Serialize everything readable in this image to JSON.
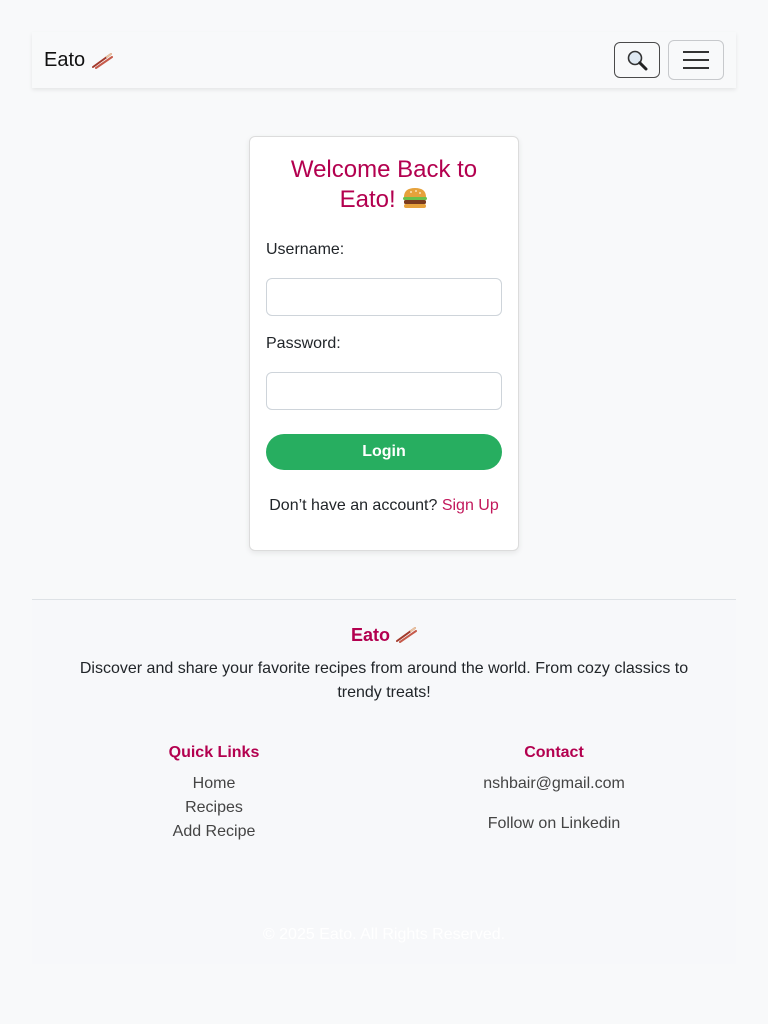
{
  "navbar": {
    "brand": "Eato",
    "brand_icon": "chopsticks-icon",
    "search_icon": "magnifier-icon",
    "menu_icon": "hamburger-menu-icon"
  },
  "login": {
    "title": "Welcome Back to Eato!",
    "title_icon": "burger-icon",
    "username_label": "Username:",
    "username_value": "",
    "password_label": "Password:",
    "password_value": "",
    "button_label": "Login",
    "signup_prompt": "Don’t have an account?",
    "signup_link": "Sign Up"
  },
  "footer": {
    "brand": "Eato",
    "description": "Discover and share your favorite recipes from around the world. From cozy classics to trendy treats!",
    "quick_links": {
      "title": "Quick Links",
      "items": [
        "Home",
        "Recipes",
        "Add Recipe"
      ]
    },
    "contact": {
      "title": "Contact",
      "email": "nshbair@gmail.com",
      "linkedin": "Follow on Linkedin"
    },
    "copyright": "© 2025 Eato. All Rights Reserved."
  },
  "colors": {
    "accent": "#b3004f",
    "link": "#c2185b",
    "button": "#27ae60",
    "background": "#f8f9fa"
  }
}
